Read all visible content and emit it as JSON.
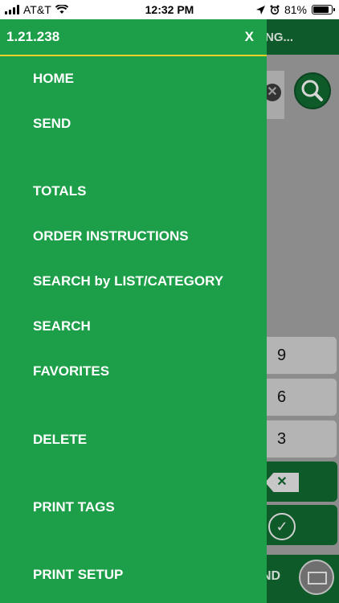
{
  "status_bar": {
    "carrier": "AT&T",
    "time": "12:32 PM",
    "battery": "81%",
    "battery_level": 0.81,
    "icons": [
      "signal-icon",
      "wifi-icon",
      "location-icon",
      "alarm-icon",
      "battery-icon"
    ]
  },
  "background": {
    "header_title": "NG...",
    "keypad": [
      "9",
      "6",
      "3"
    ],
    "send_label": "ND"
  },
  "drawer": {
    "version": "1.21.238",
    "close_label": "X",
    "items": [
      {
        "label": "HOME"
      },
      {
        "label": "SEND"
      },
      {
        "label": "TOTALS"
      },
      {
        "label": "ORDER INSTRUCTIONS"
      },
      {
        "label": "SEARCH by LIST/CATEGORY"
      },
      {
        "label": "SEARCH"
      },
      {
        "label": "FAVORITES"
      },
      {
        "label": "DELETE"
      },
      {
        "label": "PRINT TAGS"
      },
      {
        "label": "PRINT SETUP"
      }
    ]
  },
  "colors": {
    "drawer_bg": "#1d9e48",
    "divider": "#e8cf2a",
    "app_header": "#0e5a2a",
    "overlay": "#8c8c8c"
  }
}
